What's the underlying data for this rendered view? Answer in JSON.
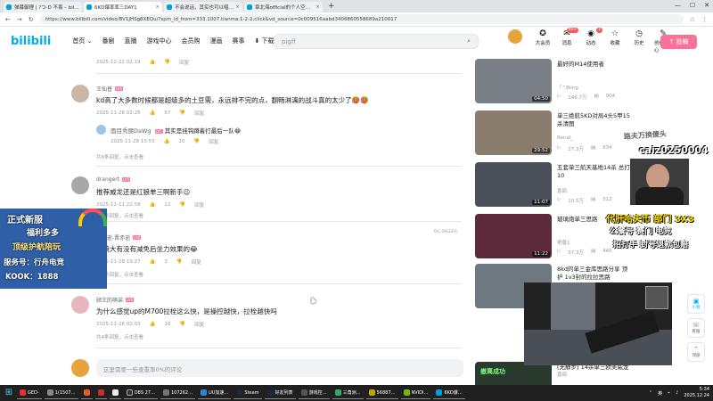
{
  "browser": {
    "tabs": [
      {
        "label": "弹幕御理 | ?つ·D 不畏 – bilibili ×"
      },
      {
        "label": "6KD爆率率三DAY1"
      },
      {
        "label": "不会说话，其实也可以唱暖的(…"
      },
      {
        "label": "章北海official的个人空间-章北海…"
      }
    ],
    "new_tab": "+",
    "url": "https://www.bilibili.com/video/BV1JHSg8XEQu/?spm_id_from=333.1007.tianma.1-2-2.click&vd_source=0c009516aabd3406860558689a210017"
  },
  "header": {
    "logo": "bilibili",
    "nav": [
      "首页 ⌄",
      "番剧",
      "直播",
      "游戏中心",
      "会员购",
      "漫画",
      "赛事",
      "⬇ 下载客户端"
    ],
    "search_value": "pigff",
    "right_items": [
      {
        "label": "大会员",
        "icon": "✪"
      },
      {
        "label": "消息",
        "icon": "✉",
        "badge": "99+"
      },
      {
        "label": "动态",
        "icon": "◉",
        "badge": "1"
      },
      {
        "label": "收藏",
        "icon": "☆"
      },
      {
        "label": "历史",
        "icon": "◷"
      },
      {
        "label": "创作中心",
        "icon": "✎"
      }
    ],
    "upload": "↑ 投稿"
  },
  "comments": {
    "top_meta": {
      "date": "2025-12-22 02:19",
      "reply": "回复"
    },
    "items": [
      {
        "user": "王仙普",
        "text": "kd高了大多数时候都是超级多的土豆需，永远排不完的点，翻畅淋漓的战斗真的太少了🥵🥵",
        "date": "2025-11-28 02:25",
        "likes": "67",
        "reply": "回复",
        "sub": {
          "user": "面目秀丽DaWg",
          "text": "其实是挂钩蹲着打最后一队😂",
          "date": "2025-11-28 10:53",
          "likes": "20",
          "reply": "回复"
        },
        "more": "共6条回复，点击查看"
      },
      {
        "user": "drangert",
        "text": "推荐威龙还是红狼单三啊新手😉",
        "date": "2025-12-11 22:58",
        "likes": "12",
        "reply": "回复",
        "more": "共5条回复，点击查看"
      },
      {
        "user": "忆已逝-晋赤逝",
        "text": "红狼大有没有减免后坐力效果的😂",
        "date": "2025-11-28 19:27",
        "likes": "3",
        "reply": "回复",
        "more": "共2条回复，点击查看"
      },
      {
        "user": "顾王的萌弟",
        "text": "为什么感觉up的M700拉栓这么快，是操控越快，拉栓越快吗",
        "date": "2025-11-28 02:03",
        "likes": "16",
        "reply": "回复",
        "more": "共4条回复，点击查看"
      }
    ],
    "input_placeholder": "这里需要一些查重率0%的评论",
    "ad_logo_text": "DG DIGGER"
  },
  "left_ad": {
    "lines": [
      "正式新服",
      "福利多多",
      "顶级护航陪玩",
      "服务号：行舟电竞",
      "KOOK：1888"
    ]
  },
  "recommend": [
    {
      "title": "最好的M14使用者",
      "uploader": "「^Bling",
      "views": "146.7万",
      "danmaku": "904",
      "duration": "04:50"
    },
    {
      "title": "单三绝航5KD对局4头5甲15杀清图",
      "uploader": "Renal_",
      "views": "27.3万",
      "danmaku": "634",
      "duration": "29:52"
    },
    {
      "title": "五套单三航天基地14杀 总打10",
      "uploader": "香鸽",
      "views": "10.5万",
      "danmaku": "512",
      "duration": "11:07"
    },
    {
      "title": "玻璃炮单三思路",
      "uploader": "奇善1",
      "views": "57.3万",
      "danmaku": "445",
      "duration": "11:22"
    },
    {
      "title": "8kd的单三金库思路分享 顶护 1v3封的拉拉思路",
      "uploader": "",
      "views": "",
      "danmaku": "",
      "duration": ""
    },
    {
      "title": "[无静步] 14杀单三欧美威龙",
      "uploader": "香鸽",
      "views": "",
      "danmaku": "",
      "duration": ""
    }
  ],
  "stream_overlay": {
    "line1": "caiz0250004",
    "line2": "路夫万换傻头",
    "line3": "代肝哈夫币 部门 3X3",
    "line4": "公餐号 赛门 电竞",
    "line5": "招打手 封号退款包赔"
  },
  "game_tag": "撤离成功",
  "side_buttons": [
    {
      "label": "小窗",
      "icon": "▣"
    },
    {
      "label": "客服",
      "icon": "☏"
    },
    {
      "label": "顶部",
      "icon": "⌃"
    }
  ],
  "taskbar": {
    "items": [
      "GED-",
      "1(1507…",
      "OBS 27…",
      "107262…",
      "UU加速…",
      "Steam",
      "好友列表",
      "游戏控…",
      "三角洲…",
      "56887…",
      "NVIDI…",
      "6KD爆…"
    ],
    "time": "5:34",
    "date": "2025.12.24",
    "lang": "英"
  }
}
